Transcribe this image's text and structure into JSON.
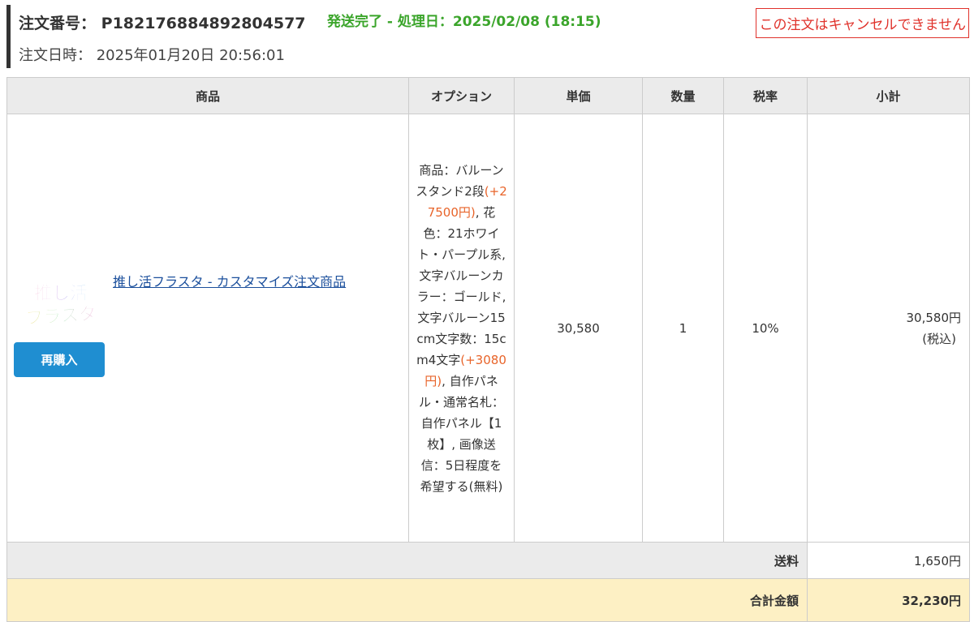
{
  "order": {
    "number_label": "注文番号：",
    "number": "P182176884892804577",
    "status": "発送完了 - 処理日：2025/02/08 (18:15)",
    "date_label": "注文日時：",
    "date": "2025年01月20日 20:56:01",
    "cancel_notice": "この注文はキャンセルできません"
  },
  "table": {
    "headers": {
      "product": "商品",
      "options": "オプション",
      "unit_price": "単価",
      "quantity": "数量",
      "tax_rate": "税率",
      "subtotal": "小計"
    },
    "item": {
      "logo_line1": "推し活",
      "logo_line2": "フラスタ",
      "rebuy_label": "再購入",
      "product_name": "推し活フラスタ - カスタマイズ注文商品",
      "options": {
        "part1": "商品：バルーンスタンド2段",
        "price1": "(+27500円)",
        "part2": ", 花色：21ホワイト・パープル系, 文字バルーンカラー：ゴールド, 文字バルーン15cm文字数：15cm4文字",
        "price2": "(+3080円)",
        "part3": ", 自作パネル・通常名札：自作パネル【1枚】, 画像送信：5日程度を希望する(無料)"
      },
      "unit_price": "30,580",
      "quantity": "1",
      "tax_rate": "10%",
      "subtotal": "30,580円",
      "subtotal_note": "(税込)"
    },
    "shipping": {
      "label": "送料",
      "value": "1,650円"
    },
    "total": {
      "label": "合計金額",
      "value": "32,230円"
    }
  },
  "colors": {
    "status_green": "#3ba52b",
    "cancel_red": "#e0322b",
    "button_blue": "#1f8ed1",
    "link_blue": "#1b4f9c",
    "price_orange": "#e8642a",
    "total_red": "#c8102e",
    "total_bg": "#fdf0c4",
    "header_bg": "#ebebeb"
  }
}
